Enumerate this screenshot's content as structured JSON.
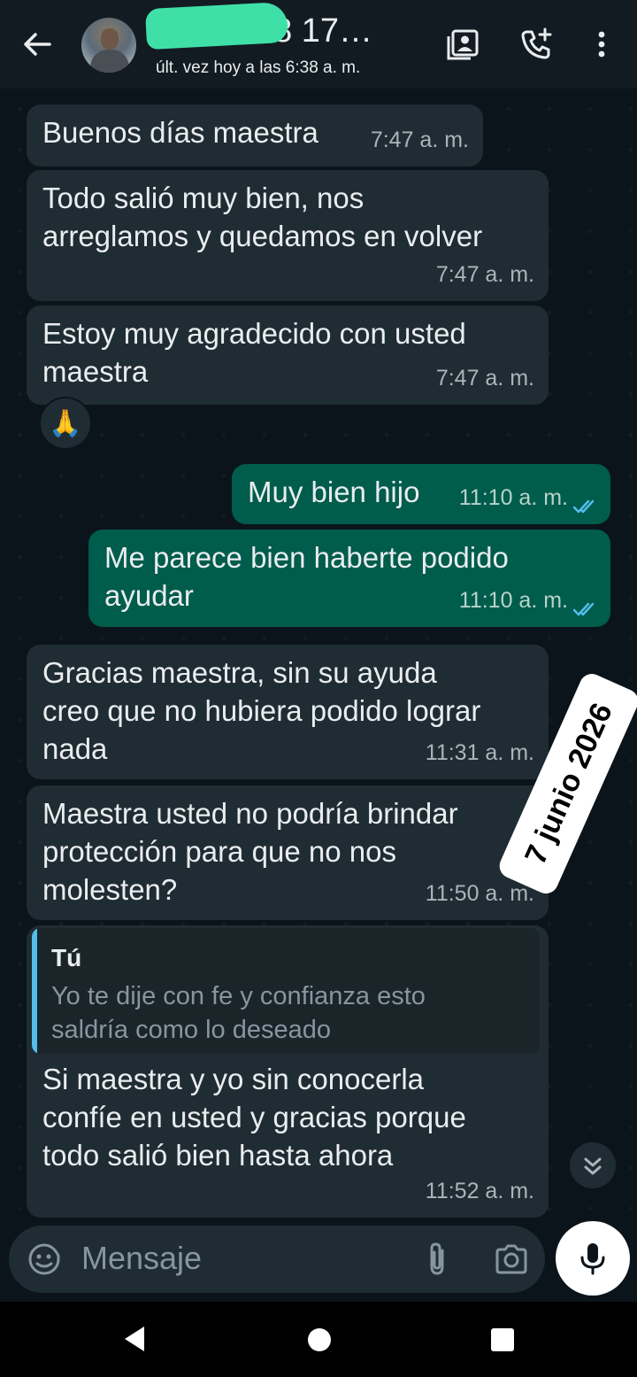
{
  "header": {
    "title": "96… 228 17…",
    "status": "últ. vez hoy a las 6:38 a. m."
  },
  "messages": [
    {
      "direction": "in",
      "text": "Buenos días maestra",
      "time": "7:47 a. m."
    },
    {
      "direction": "in",
      "text": "Todo salió muy bien, nos\narreglamos y quedamos en volver",
      "time": "7:47 a. m."
    },
    {
      "direction": "in",
      "text": "Estoy muy agradecido con usted\nmaestra",
      "time": "7:47 a. m.",
      "reaction": "🙏"
    },
    {
      "direction": "out",
      "text": "Muy bien hijo",
      "time": "11:10 a. m.",
      "read": true
    },
    {
      "direction": "out",
      "text": "Me parece bien haberte podido\nayudar",
      "time": "11:10 a. m.",
      "read": true
    },
    {
      "direction": "in",
      "text": "Gracias maestra, sin su ayuda\ncreo que no hubiera podido lograr\nnada",
      "time": "11:31 a. m."
    },
    {
      "direction": "in",
      "text": "Maestra usted no podría brindar\nprotección para que no nos\nmolesten?",
      "time": "11:50 a. m."
    },
    {
      "direction": "in",
      "quote": {
        "author": "Tú",
        "text": "Yo te dije con fe y confianza esto\nsaldría como lo deseado"
      },
      "text": "Si maestra y yo sin conocerla\nconfíe en usted y gracias porque\ntodo salió bien hasta ahora",
      "time": "11:52 a. m."
    }
  ],
  "overlay_date": "7 junio 2026",
  "input": {
    "placeholder": "Mensaje"
  },
  "colors": {
    "background": "#0b141a",
    "header": "#121b22",
    "incoming_bubble": "#202c33",
    "outgoing_bubble": "#005c4b",
    "read_ticks": "#53bdeb"
  }
}
